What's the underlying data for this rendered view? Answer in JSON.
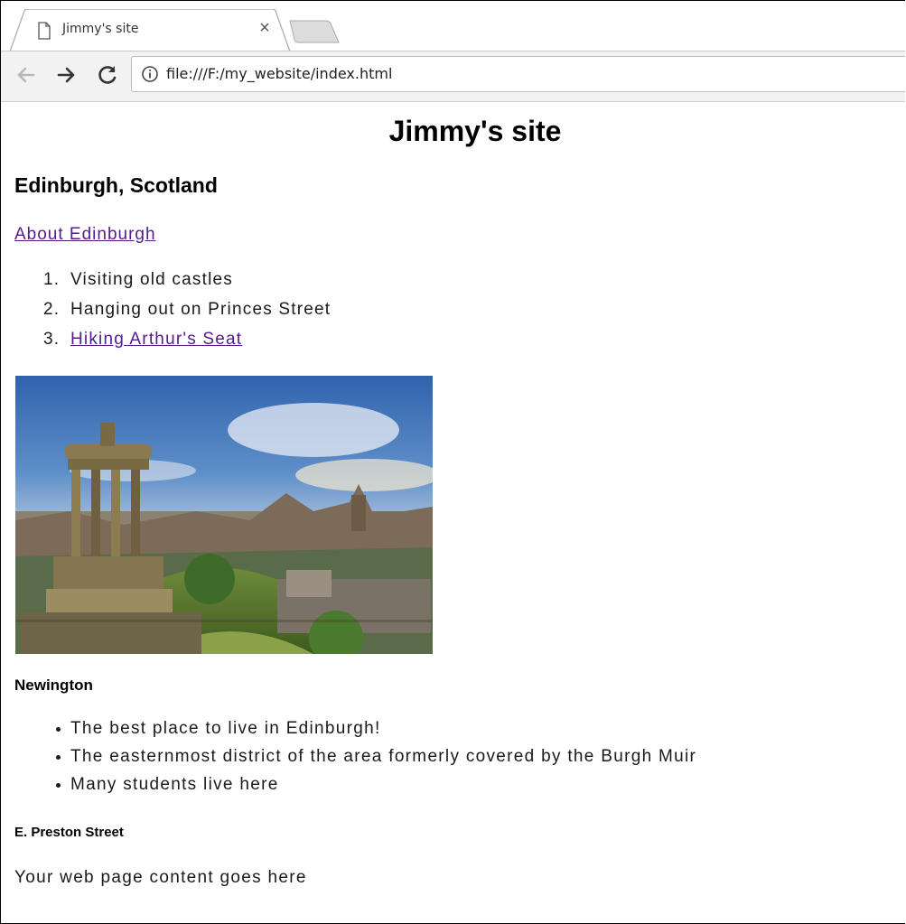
{
  "browser": {
    "tab_title": "Jimmy's site",
    "tab_close": "×",
    "url": "file:///F:/my_website/index.html",
    "icons": [
      "page-icon",
      "close-icon",
      "new-tab-icon",
      "back-arrow-icon",
      "forward-arrow-icon",
      "reload-icon",
      "info-icon"
    ]
  },
  "page": {
    "title": "Jimmy's site",
    "heading": "Edinburgh, Scotland",
    "about_link": "About Edinburgh",
    "ordered_list": [
      {
        "num": "1.",
        "text": "Visiting old castles"
      },
      {
        "num": "2.",
        "text": "Hanging out on Princes Street"
      },
      {
        "num": "3.",
        "text": "Hiking Arthur's Seat"
      }
    ],
    "subheading": "Newington",
    "bullet_list": [
      "The best place to live in Edinburgh!",
      "The easternmost district of the area formerly covered by the Burgh Muir",
      "Many students live here"
    ],
    "minor_heading": "E. Preston Street",
    "paragraph": "Your web page content goes here"
  },
  "colors": {
    "visited_link": "#551a8b",
    "toolbar_bg": "#f2f2f2"
  }
}
